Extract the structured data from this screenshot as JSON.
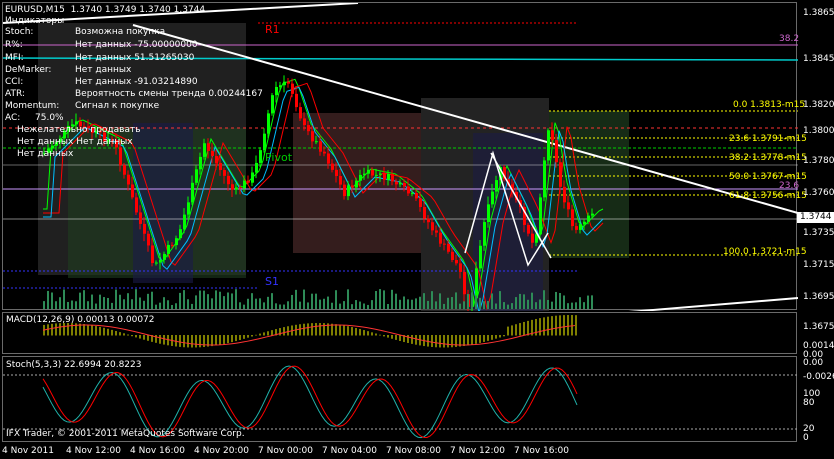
{
  "window": {
    "symbol_title": "EURUSD,M15",
    "ohlc": "1.3740 1.3749 1.3740 1.3744"
  },
  "indicators_panel": {
    "title": "Индикаторы",
    "rows": [
      {
        "name": "Stoch:",
        "value": "Возможна покупка"
      },
      {
        "name": "R%:",
        "value": "Нет данных -75.00000000"
      },
      {
        "name": "MFI:",
        "value": "Нет данных 51.51265030"
      },
      {
        "name": "DeMarker:",
        "value": "Нет данных"
      },
      {
        "name": "CCI:",
        "value": "Нет данных -91.03214890"
      },
      {
        "name": "ATR:",
        "value": "Вероятность смены тренда 0.00244167"
      },
      {
        "name": "Momentum:",
        "value": "Сигнал к покупке"
      },
      {
        "name": "AC:",
        "value": "75.0%"
      }
    ],
    "advice": [
      "Нежелательно продавать",
      "Нет данных Нет данных",
      "Нет данных"
    ]
  },
  "levels": {
    "r1": "R1",
    "s1": "S1",
    "pivot": "Pivot"
  },
  "fibo": {
    "l0": "0.0 1.3813-m15",
    "l236": "23.6 1.3791-m15",
    "l382": "38.2 1.3778-m15",
    "l500": "50.0 1.3767-m15",
    "l618": "61.8 1.3756-m15",
    "l100": "100.0 1.3721-m15",
    "fan_236": "23.6",
    "fan_382": "38.2"
  },
  "price_axis": [
    "1.3865",
    "1.3845",
    "1.3820",
    "1.3800",
    "1.3780",
    "1.3760",
    "1.3735",
    "1.3715",
    "1.3695",
    "1.3675"
  ],
  "current_price": "1.3744",
  "macd": {
    "label": "MACD(12,26,9) 0.00013 0.00072",
    "axis": [
      "0.00142",
      "0.00",
      "0.00",
      "-0.0026"
    ]
  },
  "stoch": {
    "label": "Stoch(5,3,3) 22.6994 20.8223",
    "axis": [
      "100",
      "80",
      "20",
      "0"
    ]
  },
  "copyright": "IFX Trader, © 2001-2011 MetaQuotes Software Corp.",
  "time_axis": [
    "4 Nov 2011",
    "4 Nov 12:00",
    "4 Nov 16:00",
    "4 Nov 20:00",
    "7 Nov 00:00",
    "7 Nov 04:00",
    "7 Nov 08:00",
    "7 Nov 12:00",
    "7 Nov 16:00"
  ],
  "colors": {
    "bull": "#00ff00",
    "bear": "#ff0000",
    "grid": "#6a6a6a",
    "fibo": "#ffff00",
    "trend": "#ffffff",
    "macd_hist": "#808000",
    "stoch_main": "#20b2aa",
    "stoch_signal": "#ff0000"
  }
}
